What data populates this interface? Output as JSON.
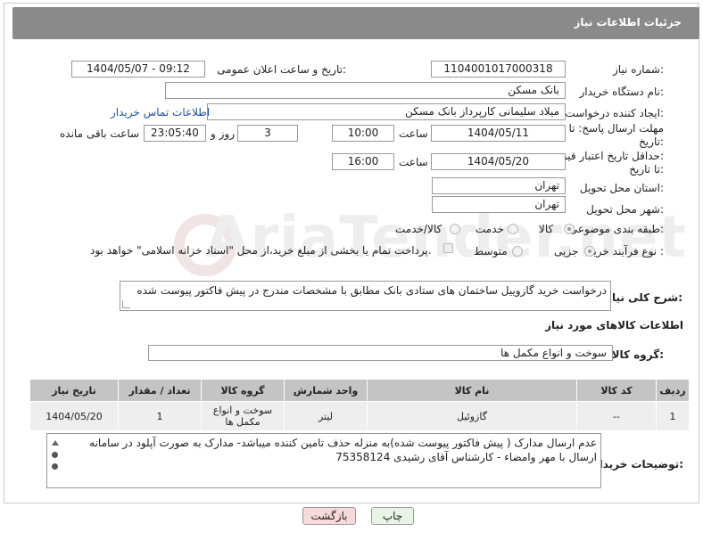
{
  "header": {
    "title": "جزئیات اطلاعات نیاز"
  },
  "fields": {
    "need_number_label": "شماره نیاز:",
    "need_number_value": "1104001017000318",
    "announce_label": "تاریخ و ساعت اعلان عمومی:",
    "announce_value": "1404/05/07 - 09:12",
    "buyer_org_label": "نام دستگاه خریدار:",
    "buyer_org_value": "بانک مسکن",
    "requester_label": "ایجاد کننده درخواست:",
    "requester_value": "میلاد سلیمانی کارپرداز بانک مسکن",
    "contact_link": "اطلاعات تماس خریدار",
    "deadline_label_1": "مهلت ارسال پاسخ: تا",
    "deadline_label_2": "تاریخ:",
    "deadline_date": "1404/05/11",
    "time_label": "ساعت",
    "deadline_time": "10:00",
    "day_count": "3",
    "day_and_label": "روز و",
    "remaining_time": "23:05:40",
    "remaining_label": "ساعت باقی مانده",
    "validity_label_1": "حداقل تاریخ اعتبار قیمت:",
    "validity_label_2": "تا تاریخ:",
    "validity_date": "1404/05/20",
    "validity_time": "16:00",
    "province_label": "استان محل تحویل:",
    "province_value": "تهران",
    "city_label": "شهر محل تحویل:",
    "city_value": "تهران",
    "category_label": "طبقه بندی موضوعی:",
    "category_options": [
      "کالا",
      "خدمت",
      "کالا/خدمت"
    ],
    "process_label": "نوع فرآیند خرید :",
    "process_options": [
      "جزیی",
      "متوسط"
    ],
    "payment_note": "پرداخت تمام یا بخشی از مبلغ خرید،از محل \"اسناد خزانه اسلامی\" خواهد بود."
  },
  "description": {
    "label": "شرح کلی نیاز:",
    "value": "درخواست خرید گازوییل ساختمان های ستادی بانک مطابق با مشخصات مندرج در پیش فاکتور پیوست شده"
  },
  "goods": {
    "section_title": "اطلاعات کالاهای مورد نیاز",
    "group_label": "گروه کالا:",
    "group_value": "سوخت و انواع مکمل ها",
    "columns": [
      "ردیف",
      "کد کالا",
      "نام کالا",
      "واحد شمارش",
      "گروه کالا",
      "تعداد / مقدار",
      "تاریخ نیاز"
    ],
    "rows": [
      [
        "1",
        "--",
        "گازوئیل",
        "لیتر",
        "سوخت و انواع مکمل ها",
        "1",
        "1404/05/20"
      ]
    ]
  },
  "buyer_notes": {
    "label": "توضیحات خریدار:",
    "value": "عدم ارسال مدارک ( پیش فاکتور پیوست شده)به منزله حذف تامین کننده میباشد- مدارک به صورت آپلود در سامانه ارسال با مهر وامضاء - کارشناس آقای رشیدی 75358124"
  },
  "buttons": {
    "print": "چاپ",
    "back": "بازگشت"
  },
  "watermark": "AriaTender.net",
  "colors": {
    "title_bg": "#8a8a8a",
    "link": "#1f4fa8",
    "back_button_bg": "#f8dada",
    "print_button_bg": "#e6f5e6"
  }
}
